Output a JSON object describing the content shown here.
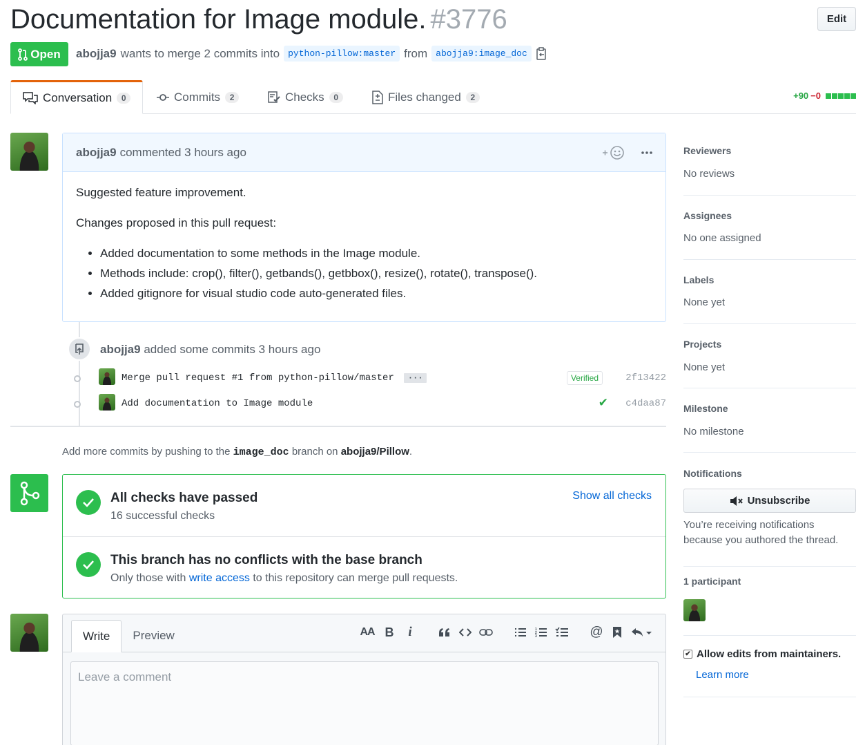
{
  "header": {
    "title": "Documentation for Image module.",
    "number": "#3776",
    "edit_label": "Edit",
    "state_label": "Open",
    "author": "abojja9",
    "merge_text": "wants to merge 2 commits into",
    "base_branch": "python-pillow:master",
    "from_text": "from",
    "head_branch": "abojja9:image_doc"
  },
  "tabs": [
    {
      "label": "Conversation",
      "count": "0"
    },
    {
      "label": "Commits",
      "count": "2"
    },
    {
      "label": "Checks",
      "count": "0"
    },
    {
      "label": "Files changed",
      "count": "2"
    }
  ],
  "diffstat": {
    "additions": "+90",
    "deletions": "−0",
    "blocks": 5
  },
  "comment": {
    "author": "abojja9",
    "action": "commented 3 hours ago",
    "paragraph1": "Suggested feature improvement.",
    "paragraph2": "Changes proposed in this pull request:",
    "bullets": [
      "Added documentation to some methods in the Image module.",
      "Methods include: crop(), filter(), getbands(), getbbox(), resize(), rotate(), transpose().",
      "Added gitignore for visual studio code auto-generated files."
    ]
  },
  "commit_event": {
    "author": "abojja9",
    "text": "added some commits 3 hours ago",
    "commits": [
      {
        "message": "Merge pull request #1 from python-pillow/master",
        "badge": "Verified",
        "sha": "2f13422"
      },
      {
        "message": "Add documentation to Image module",
        "sha": "c4daa87"
      }
    ]
  },
  "push_hint": {
    "prefix": "Add more commits by pushing to the",
    "branch": "image_doc",
    "middle": "branch on",
    "repo": "abojja9/Pillow",
    "suffix": "."
  },
  "merge": {
    "checks_title": "All checks have passed",
    "checks_sub": "16 successful checks",
    "show_checks": "Show all checks",
    "conflicts_title": "This branch has no conflicts with the base branch",
    "conflicts_prefix": "Only those with",
    "conflicts_link": "write access",
    "conflicts_suffix": "to this repository can merge pull requests."
  },
  "composer": {
    "write_tab": "Write",
    "preview_tab": "Preview",
    "placeholder": "Leave a comment",
    "toolbar": {
      "heading": "AA",
      "bold": "B",
      "italic": "i",
      "mention": "@"
    }
  },
  "sidebar": {
    "reviewers_title": "Reviewers",
    "reviewers_value": "No reviews",
    "assignees_title": "Assignees",
    "assignees_value": "No one assigned",
    "labels_title": "Labels",
    "labels_value": "None yet",
    "projects_title": "Projects",
    "projects_value": "None yet",
    "milestone_title": "Milestone",
    "milestone_value": "No milestone",
    "notifications_title": "Notifications",
    "unsubscribe_label": "Unsubscribe",
    "notifications_text": "You’re receiving notifications because you authored the thread.",
    "participants_title": "1 participant",
    "allow_edits_label": "Allow edits from maintainers.",
    "learn_more": "Learn more"
  },
  "colors": {
    "open_green": "#2cbe4e",
    "link_blue": "#0366d6",
    "active_tab_orange": "#e36209",
    "deletion_red": "#cb2431"
  }
}
